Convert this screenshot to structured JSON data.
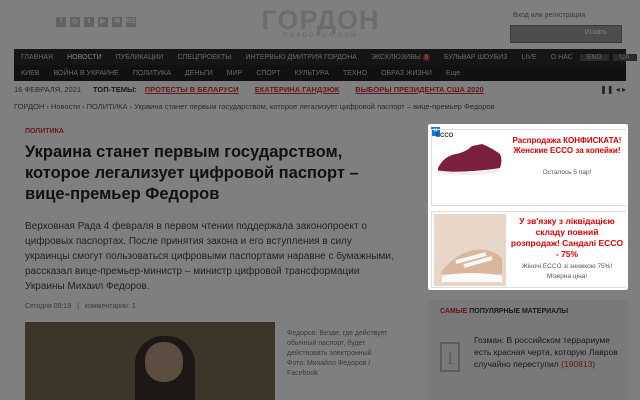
{
  "header": {
    "logo": "ГОРДОН",
    "logo_sub": "GORDONUA.COM",
    "login": "Вход или регистрация",
    "search_button": "Искать",
    "social": [
      "f",
      "◎",
      "t",
      "▶",
      "✉",
      "RSS"
    ]
  },
  "nav_main": [
    "ГЛАВНАЯ",
    "НОВОСТИ",
    "ПУБЛИКАЦИИ",
    "СПЕЦПРОЕКТЫ",
    "ИНТЕРВЬЮ ДМИТРИЯ ГОРДОНА",
    "ЭКСКЛЮЗИВЫ",
    "БУЛЬВАР ШОУБИЗ",
    "LIVE"
  ],
  "nav_main_badge": "6",
  "nav_right": {
    "about": "О НАС",
    "lang1": "ENG",
    "lang2": "UA"
  },
  "nav_sub": [
    "КИЕВ",
    "ВОЙНА В УКРАИНЕ",
    "ПОЛИТИКА",
    "ДЕНЬГИ",
    "МИР",
    "СПОРТ",
    "КУЛЬТУРА",
    "ТЕХНО",
    "ОБРАЗ ЖИЗНИ",
    "Еще"
  ],
  "topics": {
    "date": "16 ФЕВРАЛЯ, 2021",
    "label": "ТОП-ТЕМЫ:",
    "items": [
      "ПРОТЕСТЫ В БЕЛАРУСИ",
      "ЕКАТЕРИНА ГАНДЗЮК",
      "ВЫБОРЫ ПРЕЗИДЕНТА США 2020"
    ],
    "controls": "❚❚  ◂  ▸"
  },
  "breadcrumb": "ГОРДОН  ›  Новости  ›  ПОЛИТИКА  ›  Украина станет первым государством, которое легализует цифровой паспорт – вице-премьер Федоров",
  "article": {
    "section": "ПОЛИТИКА",
    "title": "Украина станет первым государством, которое легализует цифровой паспорт – вице-премьер Федоров",
    "lead": "Верховная Рада 4 февраля в первом чтении поддержала законопроект о цифровых паспортах. После принятия закона и его вступления в силу украинцы смогут пользоваться цифровыми паспортами наравне с бумажными, рассказал вице-премьер-министр – министр цифровой трансформации Украины Михаил Федоров.",
    "time": "Сегодня 09:19",
    "comments_label": "комментарии:",
    "comments_count": "1",
    "caption": "Федоров: Везде, где действует обычный паспорт, будет действовать электронный",
    "photo_credit": "Фото: Михайло Федоров / Facebook"
  },
  "ads": [
    {
      "brand": "ECCO",
      "title": "Распродажа КОНФИСКАТА! Женские ECCO за копейки!",
      "sub": "Осталось 5 пар!"
    },
    {
      "brand": "",
      "title": "У зв'язку з ліквідацією складу повний розпродаж! Сандалі ECCO - 75%",
      "sub": "Жіночі ECCO зі знижкою 75%! Мізерна ціна!"
    }
  ],
  "popular": {
    "title_red": "САМЫЕ",
    "title_rest": " ПОПУЛЯРНЫЕ МАТЕРИАЛЫ",
    "item_num": "1",
    "item_text": "Гозман: В российском террариуме есть красная черта, которую Лавров случайно переступил",
    "item_count": "(190813)"
  }
}
